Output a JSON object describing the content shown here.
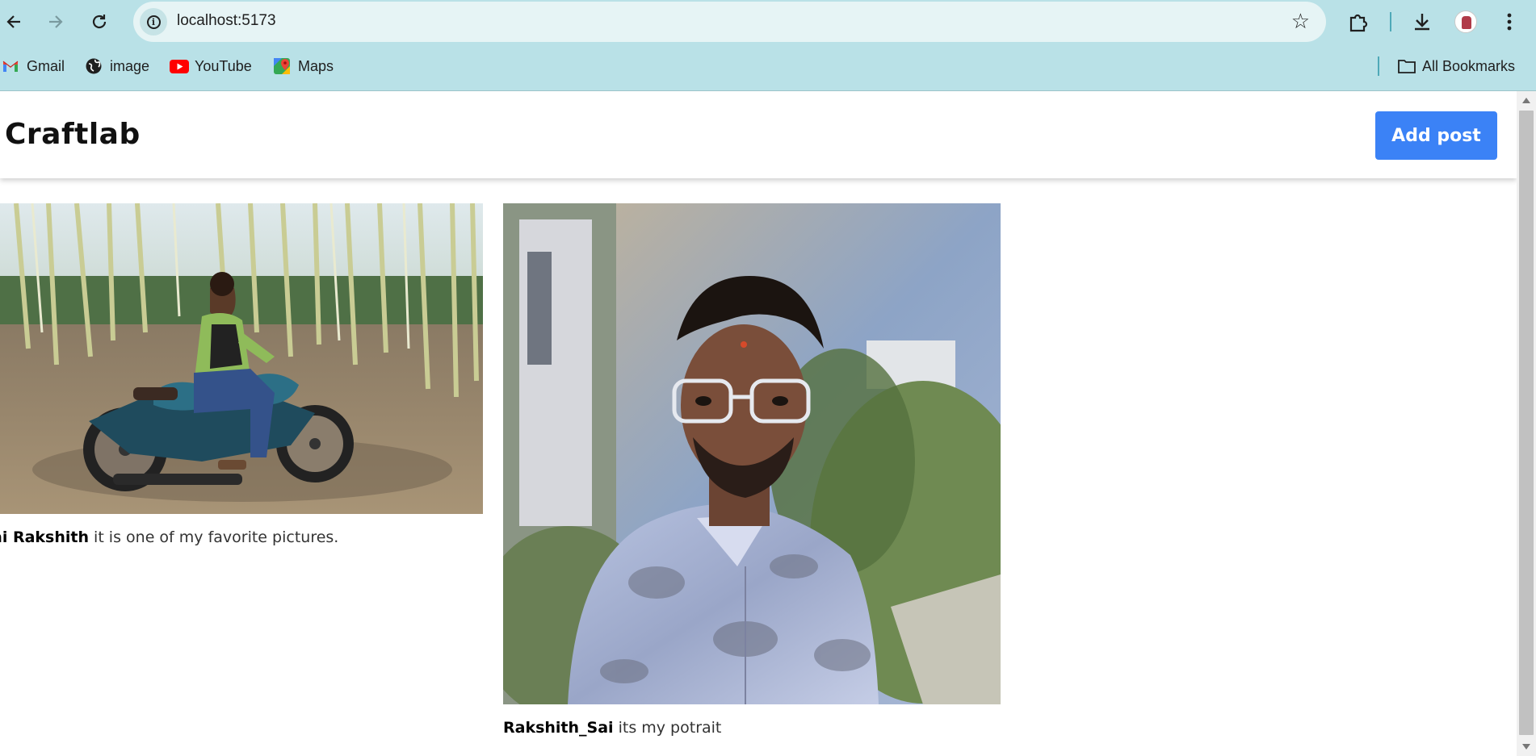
{
  "browser": {
    "url": "localhost:5173",
    "icons": {
      "back": "arrow-left-icon",
      "forward": "arrow-right-icon",
      "reload": "reload-icon",
      "info": "info-icon",
      "bookmark_star": "star-icon",
      "extensions": "puzzle-icon",
      "downloads": "download-icon",
      "menu": "kebab-menu-icon"
    },
    "bookmarks": [
      {
        "label": "Gmail",
        "icon": "gmail-icon"
      },
      {
        "label": "image",
        "icon": "globe-icon"
      },
      {
        "label": "YouTube",
        "icon": "youtube-icon"
      },
      {
        "label": "Maps",
        "icon": "maps-icon"
      }
    ],
    "all_bookmarks": "All Bookmarks"
  },
  "app": {
    "brand": "Craftlab",
    "add_post_label": "Add post",
    "accent": "#3b82f6"
  },
  "posts": [
    {
      "author": "ai Rakshith",
      "text": " it is one of my favorite pictures.",
      "image": "photo of man sitting on a teal motorcycle in a bamboo grove"
    },
    {
      "author": "Rakshith_Sai",
      "text": " its my potrait",
      "image": "portrait of man wearing glasses and a blue patterned shirt"
    }
  ]
}
